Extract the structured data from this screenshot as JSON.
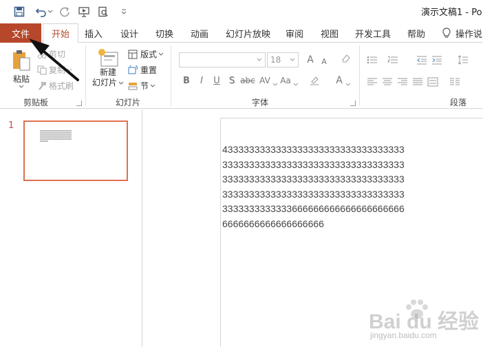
{
  "title_bar": {
    "doc_title": "演示文稿1  -  Po",
    "quick_access": [
      "save-icon",
      "undo-icon",
      "redo-icon",
      "start-from-beginning-icon",
      "print-preview-icon",
      "customize-qat-icon"
    ]
  },
  "tabs": {
    "file": "文件",
    "items": [
      "开始",
      "插入",
      "设计",
      "切换",
      "动画",
      "幻灯片放映",
      "审阅",
      "视图",
      "开发工具",
      "帮助"
    ],
    "tell_me": "操作说"
  },
  "ribbon": {
    "clipboard": {
      "label": "剪贴板",
      "paste": "粘贴",
      "cut": "剪切",
      "copy": "复制",
      "format_painter": "格式刷"
    },
    "slides": {
      "label": "幻灯片",
      "new_slide_line1": "新建",
      "new_slide_line2": "幻灯片",
      "layout": "版式",
      "reset": "重置",
      "section": "节"
    },
    "font": {
      "label": "字体",
      "font_name": "",
      "font_size": "18",
      "bold": "B",
      "italic": "I",
      "underline": "U",
      "shadow": "S",
      "strike": "abc",
      "spacing": "AV",
      "change_case": "Aa",
      "color": "A",
      "grow": "A",
      "shrink": "A"
    },
    "paragraph": {
      "label": "段落"
    }
  },
  "thumbnails": {
    "slide_number": "1"
  },
  "slide": {
    "text": "433333333333333333333333333333333333333333333333333333333333333333333333333333333333333333333333333333333333333333333333333333333333333333333333333336666666666666666666666666666666666666666"
  },
  "watermark": {
    "brand": "Bai du 经验",
    "sub": "jingyan.baidu.com"
  },
  "colors": {
    "accent": "#b7472a",
    "thumb_border": "#e1704e"
  }
}
